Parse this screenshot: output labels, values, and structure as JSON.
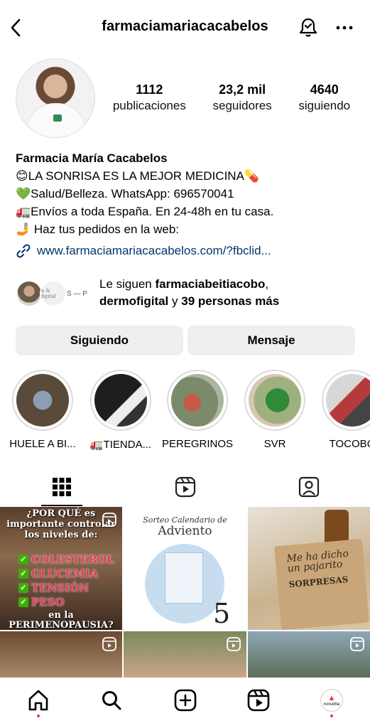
{
  "header": {
    "username": "farmaciamariacacabelos"
  },
  "stats": [
    {
      "value": "1112",
      "label": "publicaciones"
    },
    {
      "value": "23,2 mil",
      "label": "seguidores"
    },
    {
      "value": "4640",
      "label": "siguiendo"
    }
  ],
  "bio": {
    "name": "Farmacia María Cacabelos",
    "lines": [
      "😊LA SONRISA ES LA MEJOR MEDICINA💊",
      "💚Salud/Belleza. WhatsApp: 696570041",
      "🚛Envíos a toda España. En 24-48h en tu casa.",
      "🤳 Haz tus pedidos en la web:"
    ],
    "link": "www.farmaciamariacacabelos.com/?fbclid..."
  },
  "followed_by": {
    "prefix": "Le siguen ",
    "user1": "farmaciabeitiacobo",
    "sep1": ",",
    "user2": "dermofigital",
    "sep2": " y ",
    "others": "39 personas más",
    "avatar2_text": "a & figital",
    "avatar3_text": "S — P"
  },
  "buttons": {
    "following": "Siguiendo",
    "message": "Mensaje"
  },
  "highlights": [
    {
      "label": "HUELE A BI...",
      "color": "#5a4a3a"
    },
    {
      "label": "🚛TIENDA...",
      "color": "#2b2b2b"
    },
    {
      "label": "PEREGRINOS",
      "color": "#6a7a5a"
    },
    {
      "label": "SVR",
      "color": "#3d8a3a"
    },
    {
      "label": "TOCOBO",
      "color": "#b73a3a"
    }
  ],
  "posts": {
    "p1": {
      "title": "¿POR QUÉ es importante controlar los niveles de:",
      "items": [
        "COLESTEROL",
        "GLUCEMIA",
        "TENSIÓN",
        "PESO"
      ],
      "footer": "en la PERIMENOPAUSIA?"
    },
    "p2": {
      "title_script": "Sorteo Calendario de",
      "title_main": "Adviento",
      "number": "5"
    },
    "p3": {
      "card_text": "Me ha dicho un pajarito",
      "card_sub": "SORPRESAS"
    }
  },
  "colors": {
    "link": "#00376b",
    "button_bg": "#efefef",
    "notification_dot": "#ff3040"
  },
  "nav": {
    "avatar_text": "novaltia"
  }
}
